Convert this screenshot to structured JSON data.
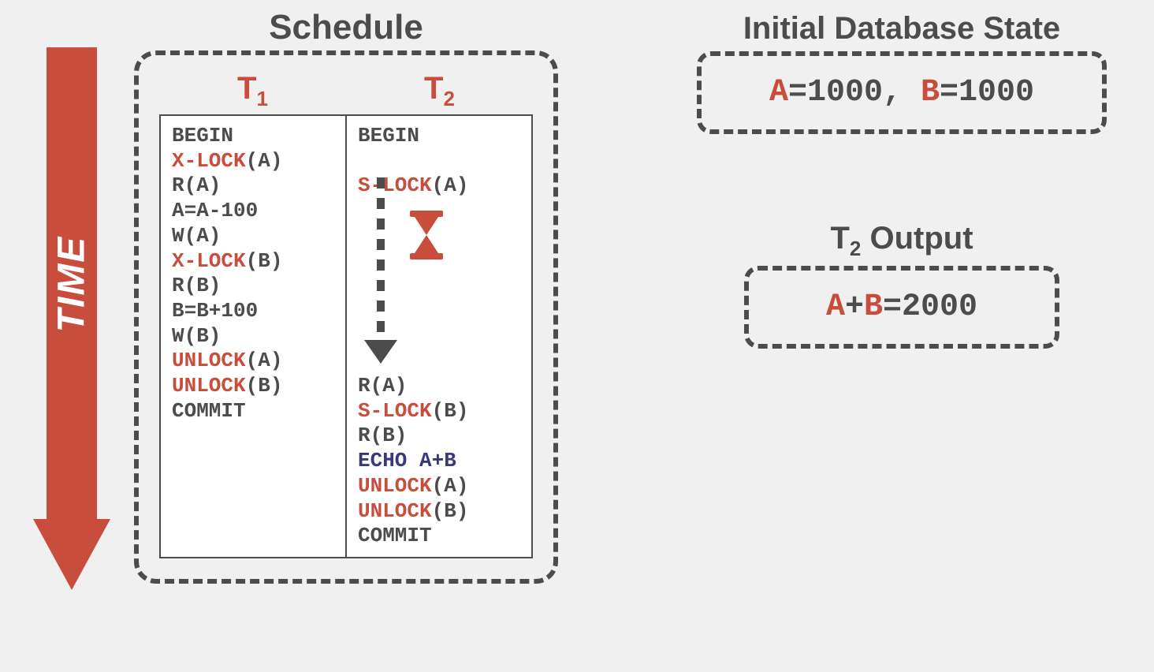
{
  "time_label": "TIME",
  "schedule": {
    "title": "Schedule",
    "headers": {
      "t1": "T",
      "t1_sub": "1",
      "t2": "T",
      "t2_sub": "2"
    },
    "t1": {
      "l0": "BEGIN",
      "l1_op": "X-LOCK",
      "l1_arg": "(A)",
      "l2": "R(A)",
      "l3": "A=A-100",
      "l4": "W(A)",
      "l5_op": "X-LOCK",
      "l5_arg": "(B)",
      "l6": "R(B)",
      "l7": "B=B+100",
      "l8": "W(B)",
      "l9_op": "UNLOCK",
      "l9_arg": "(A)",
      "l10_op": "UNLOCK",
      "l10_arg": "(B)",
      "l11": "COMMIT"
    },
    "t2": {
      "l0": "BEGIN",
      "l2_op": "S-LOCK",
      "l2_arg": "(A)",
      "l10": "R(A)",
      "l11_op": "S-LOCK",
      "l11_arg": "(B)",
      "l12": "R(B)",
      "l13_op": "ECHO",
      "l13_arg": " A+B",
      "l14_op": "UNLOCK",
      "l14_arg": "(A)",
      "l15_op": "UNLOCK",
      "l15_arg": "(B)",
      "l16": "COMMIT"
    }
  },
  "initial": {
    "title": "Initial Database State",
    "a_label": "A",
    "a_eq": "=1000, ",
    "b_label": "B",
    "b_eq": "=1000"
  },
  "output": {
    "title_pre": "T",
    "title_sub": "2",
    "title_post": " Output",
    "a_label": "A",
    "plus": "+",
    "b_label": "B",
    "eq": "=2000"
  }
}
